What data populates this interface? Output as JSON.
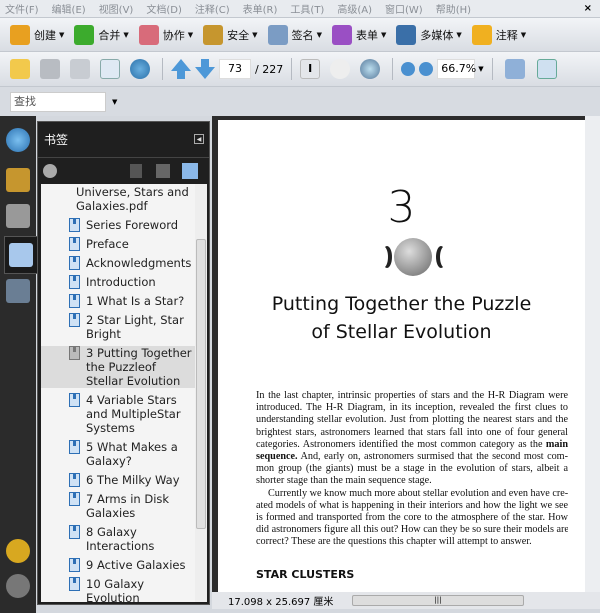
{
  "menu": [
    "文件(F)",
    "编辑(E)",
    "视图(V)",
    "文档(D)",
    "注释(C)",
    "表单(R)",
    "工具(T)",
    "高级(A)",
    "窗口(W)",
    "帮助(H)"
  ],
  "close": "×",
  "toolbar1": [
    {
      "label": "创建",
      "icon": "create-icon",
      "color": "#e8a020"
    },
    {
      "label": "合并",
      "icon": "combine-icon",
      "color": "#3cab2d"
    },
    {
      "label": "协作",
      "icon": "collaborate-icon",
      "color": "#d86b7a"
    },
    {
      "label": "安全",
      "icon": "lock-icon",
      "color": "#c6962e"
    },
    {
      "label": "签名",
      "icon": "pen-icon",
      "color": "#7b9cc4"
    },
    {
      "label": "表单",
      "icon": "form-icon",
      "color": "#9a4fc4"
    },
    {
      "label": "多媒体",
      "icon": "multimedia-icon",
      "color": "#3a6fa8"
    },
    {
      "label": "注释",
      "icon": "comment-icon",
      "color": "#f0b020"
    }
  ],
  "toolbar2": {
    "current_page": "73",
    "total_pages": "/ 227",
    "zoom": "66.7%"
  },
  "find": {
    "placeholder": "查找"
  },
  "bookmarks": {
    "title": "书签",
    "root": "Universe, Stars and Galaxies.pdf",
    "items": [
      "Series Foreword",
      "Preface",
      "Acknowledgments",
      "Introduction",
      "1 What Is a Star?",
      "2 Star Light, Star Bright",
      "3 Putting Together the Puzzleof Stellar Evolution",
      "4 Variable Stars and MultipleStar Systems",
      "5 What Makes a Galaxy?",
      "6 The Milky Way",
      "7 Arms in Disk Galaxies",
      "8 Galaxy Interactions",
      "9 Active Galaxies",
      "10 Galaxy Evolution"
    ],
    "selected": 6
  },
  "page": {
    "chapter_number": "3",
    "chapter_title_lines": [
      "Putting Together the Puzzle",
      "of Stellar Evolution"
    ],
    "paragraph_lines": [
      "In the last chapter, intrinsic properties of stars and the H-R Diagram were",
      "introduced. The H-R Diagram, in its inception, revealed the first clues to",
      "understanding stellar evolution. Just from plotting the nearest stars and the",
      "brightest stars, astronomers learned that stars fall into one of four general",
      "categories. Astronomers identified the most common category as the",
      "sequence.",
      "And, early on, astronomers surmised that the second most com-",
      "mon group (the giants) must be a stage in the evolution of stars, albeit a",
      "shorter stage than the main sequence stage.",
      "Currently we know much more about stellar evolution and even have cre-",
      "ated models of what is happening in their interiors and how the light we see",
      "is formed and transported from the core to the atmosphere of the star. How",
      "did astronomers figure all this out? How can they be so sure their models are",
      "correct? These are the questions this chapter will attempt to answer."
    ],
    "bold_main": "main",
    "section": "STAR CLUSTERS"
  },
  "status": {
    "size": "17.098 x 25.697 厘米"
  }
}
